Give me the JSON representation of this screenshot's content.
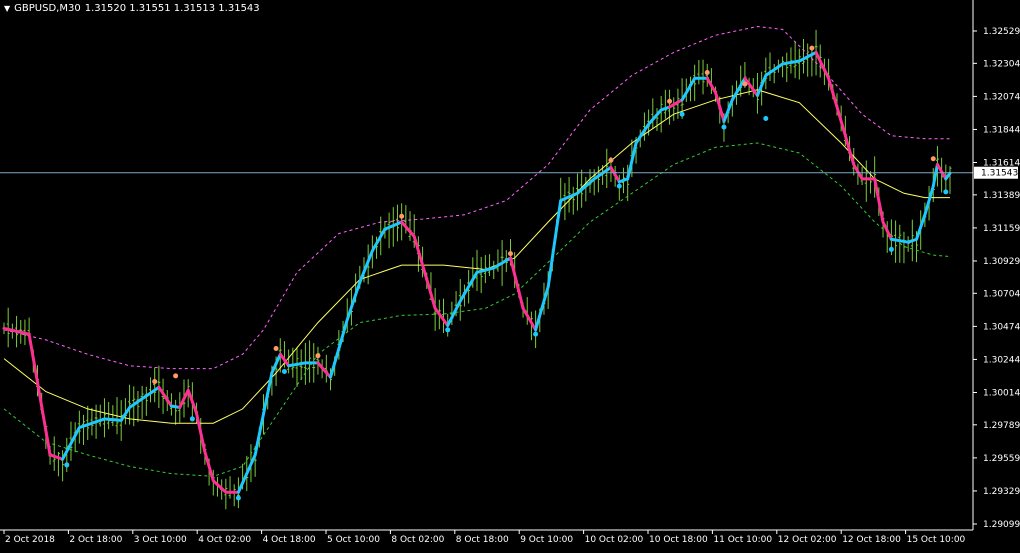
{
  "header": {
    "symbol": "GBPUSD,M30",
    "ohlc": "1.31520 1.31551 1.31513 1.31543"
  },
  "colors": {
    "background": "#000000",
    "candle": "#7ccd3a",
    "trend_up": "#1ec8ff",
    "trend_down": "#ff2e93",
    "signal_up": "#1ec8ff",
    "signal_down": "#ff9966",
    "center_band": "#ffff66",
    "upper_band": "#ff66ff",
    "lower_band": "#33cc33",
    "price_line": "#7fa9c9",
    "axis_text": "#ffffff"
  },
  "chart_data": {
    "type": "line",
    "y_axis_ticks": [
      "1.32529",
      "1.32304",
      "1.32074",
      "1.31844",
      "1.31614",
      "1.31389",
      "1.31159",
      "1.30929",
      "1.30704",
      "1.30474",
      "1.30244",
      "1.30014",
      "1.29789",
      "1.29559",
      "1.29329",
      "1.29099"
    ],
    "x_axis_ticks": [
      "2 Oct 2018",
      "2 Oct 18:00",
      "3 Oct 10:00",
      "4 Oct 02:00",
      "4 Oct 18:00",
      "5 Oct 10:00",
      "8 Oct 02:00",
      "8 Oct 18:00",
      "9 Oct 10:00",
      "10 Oct 02:00",
      "10 Oct 18:00",
      "11 Oct 10:00",
      "12 Oct 02:00",
      "12 Oct 18:00",
      "15 Oct 10:00"
    ],
    "ylim": [
      1.29099,
      1.32529
    ],
    "current_price": "1.31543",
    "x_index_range": [
      0,
      226
    ],
    "price_path": [
      [
        0,
        1.3046
      ],
      [
        6,
        1.3042
      ],
      [
        11,
        1.2958
      ],
      [
        14,
        1.2955
      ],
      [
        18,
        1.2977
      ],
      [
        24,
        1.2983
      ],
      [
        28,
        1.2982
      ],
      [
        30,
        1.2991
      ],
      [
        34,
        1.2999
      ],
      [
        37,
        1.3005
      ],
      [
        40,
        1.2992
      ],
      [
        42,
        1.2991
      ],
      [
        44,
        1.3003
      ],
      [
        46,
        1.2987
      ],
      [
        48,
        1.296
      ],
      [
        50,
        1.294
      ],
      [
        53,
        1.2932
      ],
      [
        56,
        1.2932
      ],
      [
        60,
        1.2958
      ],
      [
        64,
        1.3015
      ],
      [
        66,
        1.3028
      ],
      [
        68,
        1.302
      ],
      [
        72,
        1.3022
      ],
      [
        75,
        1.3022
      ],
      [
        78,
        1.3012
      ],
      [
        82,
        1.3052
      ],
      [
        85,
        1.3078
      ],
      [
        88,
        1.31
      ],
      [
        91,
        1.3115
      ],
      [
        95,
        1.312
      ],
      [
        98,
        1.311
      ],
      [
        100,
        1.309
      ],
      [
        103,
        1.306
      ],
      [
        106,
        1.3048
      ],
      [
        109,
        1.3065
      ],
      [
        113,
        1.3085
      ],
      [
        117,
        1.3088
      ],
      [
        121,
        1.3095
      ],
      [
        124,
        1.306
      ],
      [
        127,
        1.3045
      ],
      [
        130,
        1.3075
      ],
      [
        133,
        1.3135
      ],
      [
        137,
        1.314
      ],
      [
        141,
        1.315
      ],
      [
        145,
        1.3158
      ],
      [
        147,
        1.3148
      ],
      [
        149,
        1.315
      ],
      [
        151,
        1.3175
      ],
      [
        154,
        1.3188
      ],
      [
        157,
        1.3198
      ],
      [
        159,
        1.32
      ],
      [
        162,
        1.3205
      ],
      [
        165,
        1.322
      ],
      [
        168,
        1.322
      ],
      [
        170,
        1.321
      ],
      [
        172,
        1.319
      ],
      [
        174,
        1.3205
      ],
      [
        177,
        1.322
      ],
      [
        180,
        1.3208
      ],
      [
        182,
        1.3222
      ],
      [
        186,
        1.323
      ],
      [
        190,
        1.3232
      ],
      [
        194,
        1.3238
      ],
      [
        197,
        1.322
      ],
      [
        199,
        1.32
      ],
      [
        201,
        1.318
      ],
      [
        203,
        1.316
      ],
      [
        205,
        1.315
      ],
      [
        208,
        1.315
      ],
      [
        210,
        1.312
      ],
      [
        212,
        1.3108
      ],
      [
        216,
        1.3106
      ],
      [
        218,
        1.3108
      ],
      [
        220,
        1.3125
      ],
      [
        222,
        1.3145
      ],
      [
        223,
        1.316
      ],
      [
        225,
        1.315
      ],
      [
        226,
        1.3154
      ]
    ],
    "trend_segments": [
      {
        "dir": "down",
        "from": 0,
        "to": 14
      },
      {
        "dir": "up",
        "from": 14,
        "to": 37
      },
      {
        "dir": "down",
        "from": 37,
        "to": 40
      },
      {
        "dir": "up",
        "from": 40,
        "to": 42
      },
      {
        "dir": "down",
        "from": 42,
        "to": 56
      },
      {
        "dir": "up",
        "from": 56,
        "to": 66
      },
      {
        "dir": "down",
        "from": 66,
        "to": 68
      },
      {
        "dir": "up",
        "from": 68,
        "to": 75
      },
      {
        "dir": "down",
        "from": 75,
        "to": 78
      },
      {
        "dir": "up",
        "from": 78,
        "to": 95
      },
      {
        "dir": "down",
        "from": 95,
        "to": 106
      },
      {
        "dir": "up",
        "from": 106,
        "to": 121
      },
      {
        "dir": "down",
        "from": 121,
        "to": 127
      },
      {
        "dir": "up",
        "from": 127,
        "to": 145
      },
      {
        "dir": "down",
        "from": 145,
        "to": 147
      },
      {
        "dir": "up",
        "from": 147,
        "to": 159
      },
      {
        "dir": "down",
        "from": 159,
        "to": 162
      },
      {
        "dir": "up",
        "from": 162,
        "to": 168
      },
      {
        "dir": "down",
        "from": 168,
        "to": 172
      },
      {
        "dir": "up",
        "from": 172,
        "to": 177
      },
      {
        "dir": "down",
        "from": 177,
        "to": 180
      },
      {
        "dir": "up",
        "from": 180,
        "to": 194
      },
      {
        "dir": "down",
        "from": 194,
        "to": 212
      },
      {
        "dir": "up",
        "from": 212,
        "to": 223
      },
      {
        "dir": "down",
        "from": 223,
        "to": 225
      },
      {
        "dir": "up",
        "from": 225,
        "to": 226
      }
    ],
    "center_band": [
      [
        0,
        1.3025
      ],
      [
        10,
        1.3002
      ],
      [
        20,
        1.299
      ],
      [
        30,
        1.2983
      ],
      [
        40,
        1.298
      ],
      [
        50,
        1.298
      ],
      [
        57,
        1.299
      ],
      [
        65,
        1.3015
      ],
      [
        75,
        1.305
      ],
      [
        85,
        1.308
      ],
      [
        95,
        1.309
      ],
      [
        105,
        1.309
      ],
      [
        115,
        1.3087
      ],
      [
        122,
        1.3095
      ],
      [
        130,
        1.312
      ],
      [
        140,
        1.315
      ],
      [
        150,
        1.3175
      ],
      [
        160,
        1.3195
      ],
      [
        170,
        1.3205
      ],
      [
        180,
        1.3212
      ],
      [
        190,
        1.3203
      ],
      [
        200,
        1.3175
      ],
      [
        208,
        1.315
      ],
      [
        215,
        1.314
      ],
      [
        220,
        1.3137
      ],
      [
        226,
        1.3137
      ]
    ],
    "upper_band": [
      [
        0,
        1.3045
      ],
      [
        10,
        1.3038
      ],
      [
        20,
        1.3028
      ],
      [
        30,
        1.302
      ],
      [
        40,
        1.3018
      ],
      [
        50,
        1.3018
      ],
      [
        57,
        1.3028
      ],
      [
        62,
        1.3045
      ],
      [
        70,
        1.3085
      ],
      [
        80,
        1.3112
      ],
      [
        90,
        1.312
      ],
      [
        100,
        1.3122
      ],
      [
        110,
        1.3125
      ],
      [
        120,
        1.3135
      ],
      [
        130,
        1.316
      ],
      [
        140,
        1.3198
      ],
      [
        150,
        1.3222
      ],
      [
        160,
        1.3238
      ],
      [
        170,
        1.325
      ],
      [
        180,
        1.3256
      ],
      [
        186,
        1.3254
      ],
      [
        195,
        1.3228
      ],
      [
        205,
        1.3195
      ],
      [
        212,
        1.318
      ],
      [
        220,
        1.3178
      ],
      [
        226,
        1.3178
      ]
    ],
    "lower_band": [
      [
        0,
        1.299
      ],
      [
        10,
        1.2967
      ],
      [
        20,
        1.2958
      ],
      [
        30,
        1.295
      ],
      [
        40,
        1.2945
      ],
      [
        50,
        1.2943
      ],
      [
        57,
        1.295
      ],
      [
        65,
        1.2985
      ],
      [
        75,
        1.3028
      ],
      [
        85,
        1.305
      ],
      [
        95,
        1.3055
      ],
      [
        105,
        1.3056
      ],
      [
        115,
        1.306
      ],
      [
        122,
        1.307
      ],
      [
        130,
        1.3092
      ],
      [
        140,
        1.312
      ],
      [
        150,
        1.314
      ],
      [
        160,
        1.316
      ],
      [
        170,
        1.3172
      ],
      [
        180,
        1.3175
      ],
      [
        190,
        1.3168
      ],
      [
        200,
        1.3145
      ],
      [
        208,
        1.312
      ],
      [
        215,
        1.3103
      ],
      [
        222,
        1.3097
      ],
      [
        226,
        1.3096
      ]
    ],
    "signal_up": [
      [
        15,
        1.2951
      ],
      [
        45,
        1.2983
      ],
      [
        56,
        1.2928
      ],
      [
        67,
        1.3016
      ],
      [
        106,
        1.3045
      ],
      [
        127,
        1.3042
      ],
      [
        147,
        1.3145
      ],
      [
        162,
        1.3195
      ],
      [
        172,
        1.3186
      ],
      [
        182,
        1.3192
      ],
      [
        212,
        1.3101
      ],
      [
        225,
        1.3141
      ]
    ],
    "signal_down": [
      [
        36,
        1.3009
      ],
      [
        41,
        1.3013
      ],
      [
        65,
        1.3032
      ],
      [
        75,
        1.3027
      ],
      [
        95,
        1.3124
      ],
      [
        121,
        1.3098
      ],
      [
        145,
        1.3163
      ],
      [
        159,
        1.3204
      ],
      [
        168,
        1.3224
      ],
      [
        177,
        1.3216
      ],
      [
        193,
        1.3241
      ],
      [
        222,
        1.3164
      ]
    ]
  }
}
